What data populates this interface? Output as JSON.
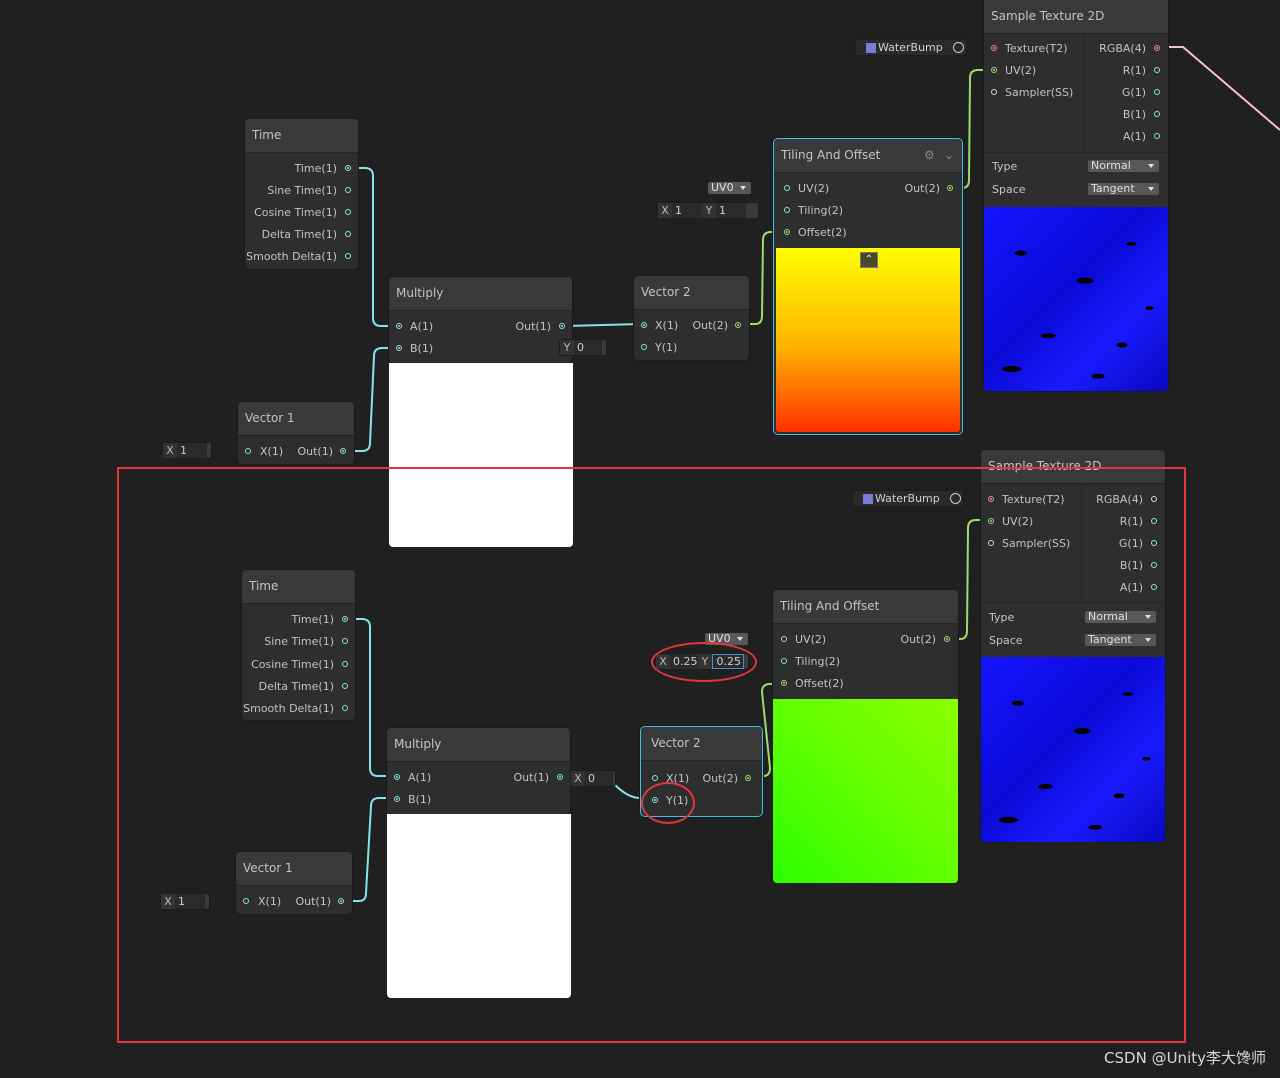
{
  "nodes": {
    "time": {
      "title": "Time",
      "outputs": [
        "Time(1)",
        "Sine Time(1)",
        "Cosine Time(1)",
        "Delta Time(1)",
        "Smooth Delta(1)"
      ]
    },
    "multiply": {
      "title": "Multiply",
      "in_a": "A(1)",
      "in_b": "B(1)",
      "out": "Out(1)"
    },
    "vector1": {
      "title": "Vector 1",
      "in_x": "X(1)",
      "out": "Out(1)",
      "x_label": "X",
      "x_value": "1"
    },
    "vector2": {
      "title": "Vector 2",
      "in_x": "X(1)",
      "in_y": "Y(1)",
      "out": "Out(2)",
      "y_label": "Y",
      "y_value": "0",
      "x_label": "X",
      "x_value": "0"
    },
    "tiling": {
      "title": "Tiling And Offset",
      "in_uv": "UV(2)",
      "in_tiling": "Tiling(2)",
      "in_offset": "Offset(2)",
      "out": "Out(2)",
      "uv_channel": "UV0",
      "tiling_top": {
        "x_label": "X",
        "x": "1",
        "y_label": "Y",
        "y": "1"
      },
      "tiling_bottom": {
        "x_label": "X",
        "x": "0.25",
        "y_label": "Y",
        "y": "0.25"
      },
      "collapse_icon": "chevron-up-icon"
    },
    "sample": {
      "title": "Sample Texture 2D",
      "in_texture": "Texture(T2)",
      "in_uv": "UV(2)",
      "in_sampler": "Sampler(SS)",
      "outputs": [
        "RGBA(4)",
        "R(1)",
        "G(1)",
        "B(1)",
        "A(1)"
      ],
      "texture_name": "WaterBump",
      "type_label": "Type",
      "type_value": "Normal",
      "space_label": "Space",
      "space_value": "Tangent"
    }
  },
  "colors": {
    "wire_vector1": "#84e4e7",
    "wire_vector2": "#9ddc6a",
    "wire_texture": "#f08a9a",
    "highlight": "#e03838",
    "selection": "#44c0e6"
  },
  "watermark": "CSDN @Unity李大馋师"
}
